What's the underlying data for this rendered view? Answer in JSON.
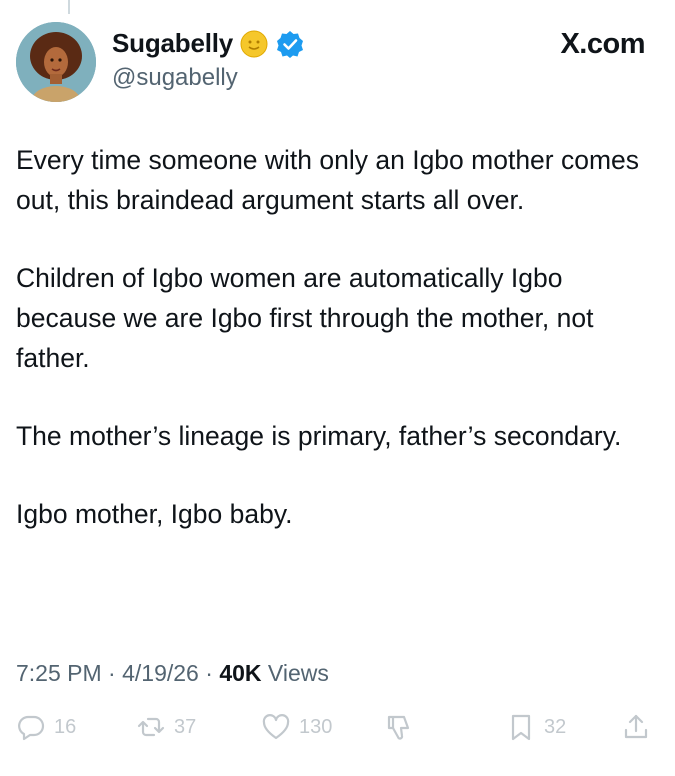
{
  "author": {
    "display_name": "Sugabelly",
    "handle": "@sugabelly",
    "badge_emoji_icon": "sun-emoji-icon",
    "verified_icon": "verified-badge-icon",
    "verified_color": "#1d9bf0"
  },
  "brand": "X.com",
  "tweet": {
    "paragraphs": [
      "Every time someone with only an Igbo mother comes out, this braindead argument starts all over.",
      "Children of Igbo women are automatically Igbo because we are Igbo first through the mother, not father.",
      "The mother’s lineage is primary, father’s secondary.",
      "Igbo mother, Igbo baby."
    ]
  },
  "meta": {
    "time": "7:25 PM",
    "separator": " · ",
    "date": "4/19/26",
    "views_count": "40K",
    "views_label": " Views"
  },
  "actions": {
    "replies": "16",
    "reposts": "37",
    "likes": "130",
    "bookmarks": "32"
  }
}
